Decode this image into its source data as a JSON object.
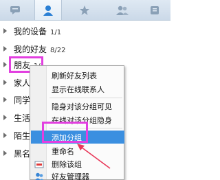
{
  "tabs": [
    {
      "name": "messages",
      "icon": "chat-bubble-icon"
    },
    {
      "name": "contacts",
      "icon": "person-icon",
      "active": true
    },
    {
      "name": "favorites",
      "icon": "star-icon"
    },
    {
      "name": "groups",
      "icon": "group-icon"
    },
    {
      "name": "recent",
      "icon": "recent-icon"
    }
  ],
  "groups": [
    {
      "name": "我的设备",
      "count": "1/1"
    },
    {
      "name": "我的好友",
      "count": "8/22"
    },
    {
      "name": "朋友",
      "count": "1/"
    },
    {
      "name": "家人",
      "count": ""
    },
    {
      "name": "同学",
      "count": ""
    },
    {
      "name": "生活",
      "count": ""
    },
    {
      "name": "陌生",
      "count": ""
    },
    {
      "name": "黑名",
      "count": ""
    }
  ],
  "menu": {
    "items": [
      {
        "label": "刷新好友列表"
      },
      {
        "label": "显示在线联系人"
      },
      {
        "label": "隐身对该分组可见"
      },
      {
        "label": "在线对该分组隐身"
      },
      {
        "label": "添加分组"
      },
      {
        "label": "重命名"
      },
      {
        "label": "删除该组"
      },
      {
        "label": "好友管理器"
      }
    ]
  },
  "colors": {
    "highlight": "#e23fe0",
    "menu_selected": "#3b8fe0",
    "annotation_arrow": "#e8395a"
  }
}
